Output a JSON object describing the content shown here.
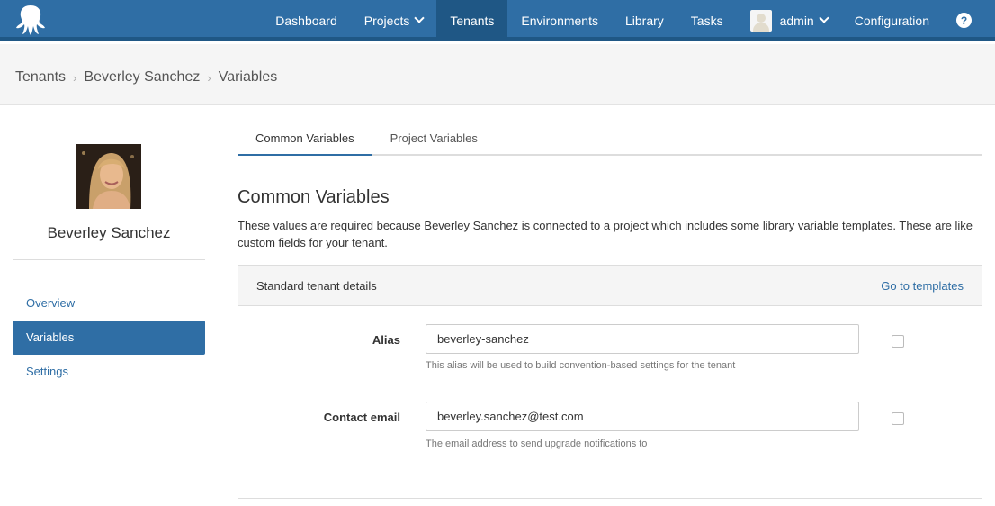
{
  "nav": {
    "items": [
      {
        "label": "Dashboard"
      },
      {
        "label": "Projects"
      },
      {
        "label": "Tenants"
      },
      {
        "label": "Environments"
      },
      {
        "label": "Library"
      },
      {
        "label": "Tasks"
      },
      {
        "label": "admin"
      },
      {
        "label": "Configuration"
      }
    ],
    "help_glyph": "?"
  },
  "breadcrumb": {
    "items": [
      "Tenants",
      "Beverley Sanchez",
      "Variables"
    ],
    "separator": "›"
  },
  "tenant": {
    "name": "Beverley Sanchez"
  },
  "sidebar": {
    "items": [
      {
        "label": "Overview"
      },
      {
        "label": "Variables"
      },
      {
        "label": "Settings"
      }
    ]
  },
  "tabs": [
    {
      "label": "Common Variables"
    },
    {
      "label": "Project Variables"
    }
  ],
  "section": {
    "title": "Common Variables",
    "description": "These values are required because Beverley Sanchez is connected to a project which includes some library variable templates. These are like custom fields for your tenant."
  },
  "panel": {
    "title": "Standard tenant details",
    "link": "Go to templates",
    "fields": [
      {
        "label": "Alias",
        "value": "beverley-sanchez",
        "help": "This alias will be used to build convention-based settings for the tenant"
      },
      {
        "label": "Contact email",
        "value": "beverley.sanchez@test.com",
        "help": "The email address to send upgrade notifications to"
      }
    ]
  },
  "colors": {
    "brand": "#2f6ea5",
    "brand_dark": "#1f5785"
  }
}
